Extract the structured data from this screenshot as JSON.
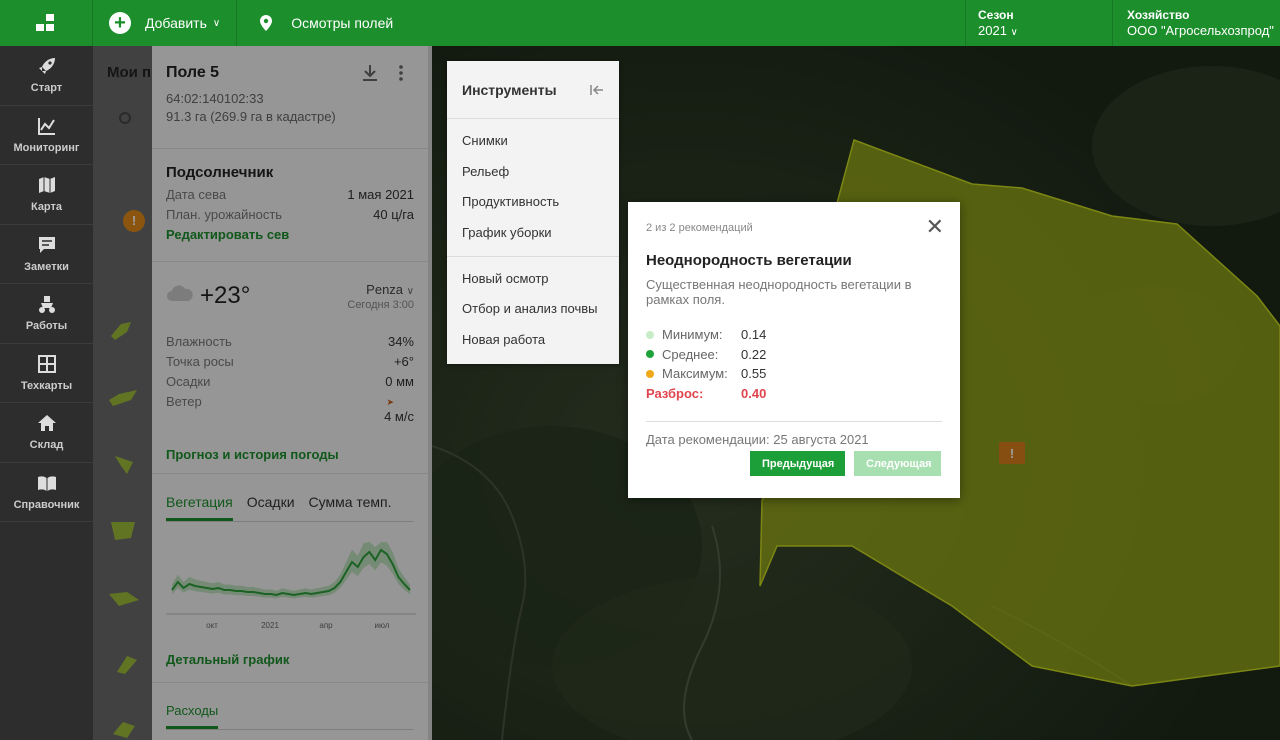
{
  "topbar": {
    "add_label": "Добавить",
    "inspect_label": "Осмотры полей",
    "season_label": "Сезон",
    "season_value": "2021",
    "farm_label": "Хозяйство",
    "farm_value": "ООО \"Агросельхозпрод\""
  },
  "nav": {
    "items": [
      {
        "label": "Старт",
        "icon": "rocket-icon"
      },
      {
        "label": "Мониторинг",
        "icon": "chart-icon"
      },
      {
        "label": "Карта",
        "icon": "map-icon"
      },
      {
        "label": "Заметки",
        "icon": "notes-icon"
      },
      {
        "label": "Работы",
        "icon": "tractor-icon"
      },
      {
        "label": "Техкарты",
        "icon": "grid-icon"
      },
      {
        "label": "Склад",
        "icon": "home-icon"
      },
      {
        "label": "Справочник",
        "icon": "book-icon"
      }
    ]
  },
  "fieldlist": {
    "header": "Мои п"
  },
  "field": {
    "name": "Поле 5",
    "cadastral": "64:02:140102:33",
    "area": "91.3 га (269.9 га в кадастре)",
    "crop": "Подсолнечник",
    "sow_date_label": "Дата сева",
    "sow_date": "1 мая 2021",
    "yield_label": "План. урожайность",
    "yield": "40 ц/га",
    "edit_sow": "Редактировать сев"
  },
  "weather": {
    "temp": "+23°",
    "location": "Penza",
    "time": "Сегодня 3:00",
    "humidity_label": "Влажность",
    "humidity": "34%",
    "dew_label": "Точка росы",
    "dew": "+6°",
    "precip_label": "Осадки",
    "precip": "0 мм",
    "wind_label": "Ветер",
    "wind": "4 м/с",
    "forecast_link": "Прогноз и история погоды"
  },
  "chart_tabs": {
    "vegetation": "Вегетация",
    "precip": "Осадки",
    "temp_sum": "Сумма темп."
  },
  "chart_data": {
    "type": "line",
    "x_ticks": [
      "окт",
      "2021",
      "апр",
      "июл"
    ],
    "series": [
      {
        "color": "#2e9e3a",
        "values": [
          0.22,
          0.3,
          0.24,
          0.28,
          0.26,
          0.25,
          0.24,
          0.23,
          0.24,
          0.22,
          0.22,
          0.21,
          0.21,
          0.2,
          0.2,
          0.19,
          0.18,
          0.18,
          0.17,
          0.19,
          0.18,
          0.17,
          0.18,
          0.19,
          0.18,
          0.19,
          0.2,
          0.21,
          0.24,
          0.3,
          0.4,
          0.5,
          0.45,
          0.55,
          0.6,
          0.52,
          0.62,
          0.58,
          0.48,
          0.35,
          0.28,
          0.22
        ]
      }
    ]
  },
  "detail_link": "Детальный график",
  "expenses_tab": "Расходы",
  "tools": {
    "title": "Инструменты",
    "group1": [
      "Снимки",
      "Рельеф",
      "Продуктивность",
      "График уборки"
    ],
    "group2": [
      "Новый осмотр",
      "Отбор и анализ почвы",
      "Новая работа"
    ]
  },
  "modal": {
    "counter": "2 из 2 рекомендаций",
    "title": "Неоднородность вегетации",
    "description": "Существенная неоднородность вегетации в рамках поля.",
    "min_label": "Минимум:",
    "min_value": "0.14",
    "min_color": "#c8ecc7",
    "mean_label": "Среднее:",
    "mean_value": "0.22",
    "mean_color": "#1ea33a",
    "max_label": "Максимум:",
    "max_value": "0.55",
    "max_color": "#f0a818",
    "spread_label": "Разброс:",
    "spread_value": "0.40",
    "date": "Дата рекомендации: 25 августа 2021",
    "prev_button": "Предыдущая",
    "next_button": "Следующая"
  },
  "colors": {
    "brand": "#1c8e2c",
    "field_fill": "#a6b81a"
  }
}
